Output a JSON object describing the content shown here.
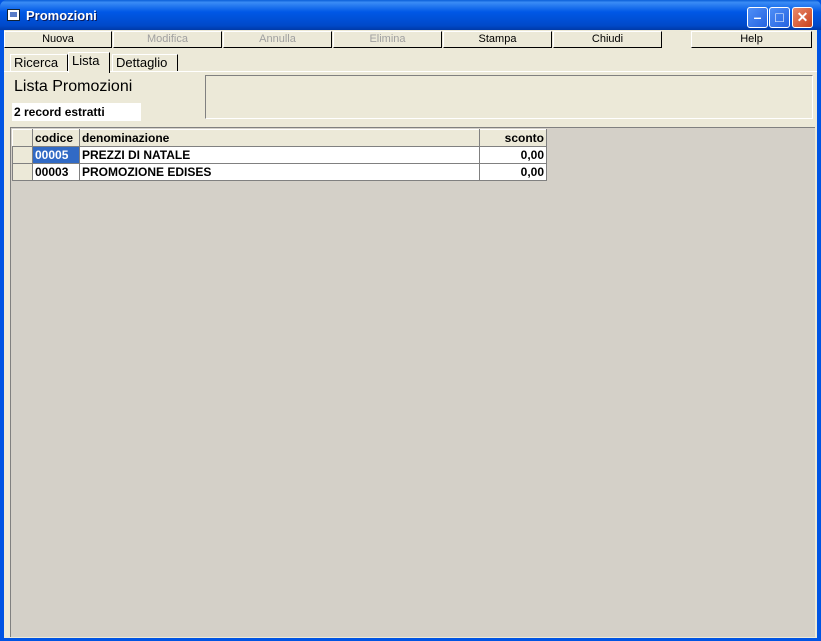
{
  "window": {
    "title": "Promozioni"
  },
  "toolbar": {
    "buttons": [
      {
        "label": "Nuova",
        "enabled": true
      },
      {
        "label": "Modifica",
        "enabled": false
      },
      {
        "label": "Annulla",
        "enabled": false
      },
      {
        "label": "Elimina",
        "enabled": false
      },
      {
        "label": "Stampa",
        "enabled": true
      },
      {
        "label": "Chiudi",
        "enabled": true
      },
      {
        "label": "Help",
        "enabled": true
      }
    ]
  },
  "tabs": [
    {
      "label": "Ricerca"
    },
    {
      "label": "Lista",
      "active": true
    },
    {
      "label": "Dettaglio"
    }
  ],
  "list": {
    "title": "Lista Promozioni",
    "record_count": "2 record estratti"
  },
  "grid": {
    "columns": [
      "codice",
      "denominazione",
      "sconto"
    ],
    "rows": [
      {
        "codice": "00005",
        "denominazione": "PREZZI DI NATALE",
        "sconto": "0,00"
      },
      {
        "codice": "00003",
        "denominazione": "PROMOZIONE EDISES",
        "sconto": "0,00"
      }
    ]
  },
  "colors": {
    "title_bar": "#0058e6",
    "selection": "#316ac5",
    "face": "#ece9d8"
  }
}
